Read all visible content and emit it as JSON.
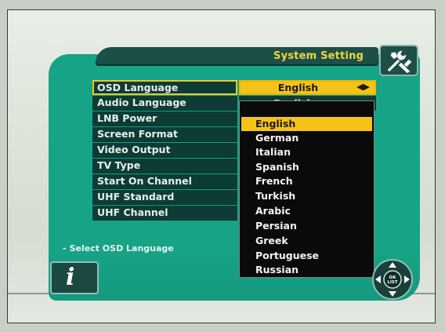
{
  "header": {
    "title": "System Setting",
    "tools_icon": "tools-icon"
  },
  "menu": {
    "items": [
      {
        "label": "OSD Language"
      },
      {
        "label": "Audio Language"
      },
      {
        "label": "LNB Power"
      },
      {
        "label": "Screen Format"
      },
      {
        "label": "Video Output"
      },
      {
        "label": "TV Type"
      },
      {
        "label": "Start On Channel"
      },
      {
        "label": "UHF Standard"
      },
      {
        "label": "UHF Channel"
      }
    ],
    "active_index": 0,
    "active_value": "English",
    "next_value_peek": "English"
  },
  "dropdown": {
    "options": [
      "English",
      "German",
      "Italian",
      "Spanish",
      "French",
      "Turkish",
      "Arabic",
      "Persian",
      "Greek",
      "Portuguese",
      "Russian"
    ],
    "selected": "English"
  },
  "hint": {
    "text": "Select OSD Language"
  },
  "info": {
    "glyph": "i",
    "icon": "info-icon"
  },
  "navpad": {
    "label": "OK LIST",
    "icon": "dpad-ok-list-icon"
  },
  "colors": {
    "accent": "#f5c318",
    "panel": "#17a386",
    "row": "#0d3c37",
    "title": "#f3d63a"
  }
}
